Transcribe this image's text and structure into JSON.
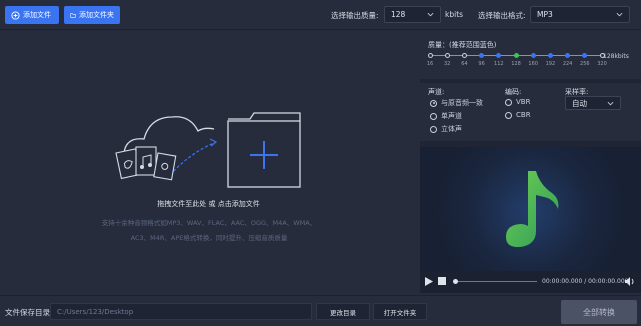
{
  "toolbar": {
    "add_file_label": "添加文件",
    "add_folder_label": "添加文件夹",
    "quality_label": "选择输出质量:",
    "quality_value": "128",
    "quality_unit": "kbits",
    "format_label": "选择输出格式:",
    "format_value": "MP3"
  },
  "droparea": {
    "title": "拖拽文件至此处 或 点击添加文件",
    "desc": "支持十余种音频格式如MP3、WAV、FLAC、AAC、OGG、M4A、WMA、AC3、M4R、APE格式转换，同时提升、压缩音质质量"
  },
  "quality": {
    "title": "质量：(推荐范围蓝色)",
    "ticks": [
      "16",
      "32",
      "64",
      "96",
      "112",
      "128",
      "160",
      "192",
      "224",
      "256",
      "320"
    ],
    "selected_index": 5,
    "recommended": [
      3,
      4,
      6,
      7,
      8,
      9
    ],
    "max_label": "128kbits"
  },
  "options": {
    "channel_label": "声道:",
    "channel_options": [
      "与原音频一致",
      "单声道",
      "立体声"
    ],
    "channel_selected": 0,
    "encoding_label": "编码:",
    "encoding_options": [
      "VBR",
      "CBR"
    ],
    "samplerate_label": "采样率:",
    "samplerate_value": "自动"
  },
  "player": {
    "time": "00:00:00.000 / 00:00:00.000"
  },
  "bottom": {
    "save_label": "文件保存目录:",
    "path_value": "C:/Users/123/Desktop",
    "change_dir_label": "更改目录",
    "open_folder_label": "打开文件夹",
    "convert_label": "全部转换"
  },
  "colors": {
    "accent": "#3a74f1",
    "selected_quality": "#3ec35a",
    "music_note": "#4caf50"
  }
}
